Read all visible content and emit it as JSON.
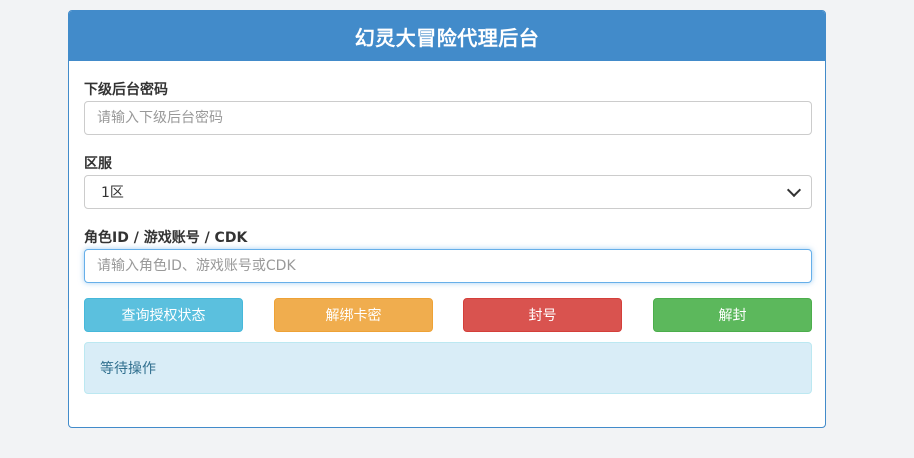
{
  "panel": {
    "title": "幻灵大冒险代理后台"
  },
  "form": {
    "password": {
      "label": "下级后台密码",
      "placeholder": "请输入下级后台密码",
      "value": ""
    },
    "server": {
      "label": "区服",
      "selected": "1区"
    },
    "target": {
      "label": "角色ID / 游戏账号 / CDK",
      "placeholder": "请输入角色ID、游戏账号或CDK",
      "value": ""
    }
  },
  "buttons": {
    "query": "查询授权状态",
    "unbind": "解绑卡密",
    "ban": "封号",
    "unban": "解封"
  },
  "status": {
    "message": "等待操作"
  },
  "colors": {
    "primary": "#428bca",
    "info": "#5bc0de",
    "warning": "#f0ad4e",
    "danger": "#d9534f",
    "success": "#5cb85c",
    "alert_bg": "#d9edf7"
  },
  "icons": {
    "select_arrow": "chevron-down-icon"
  }
}
